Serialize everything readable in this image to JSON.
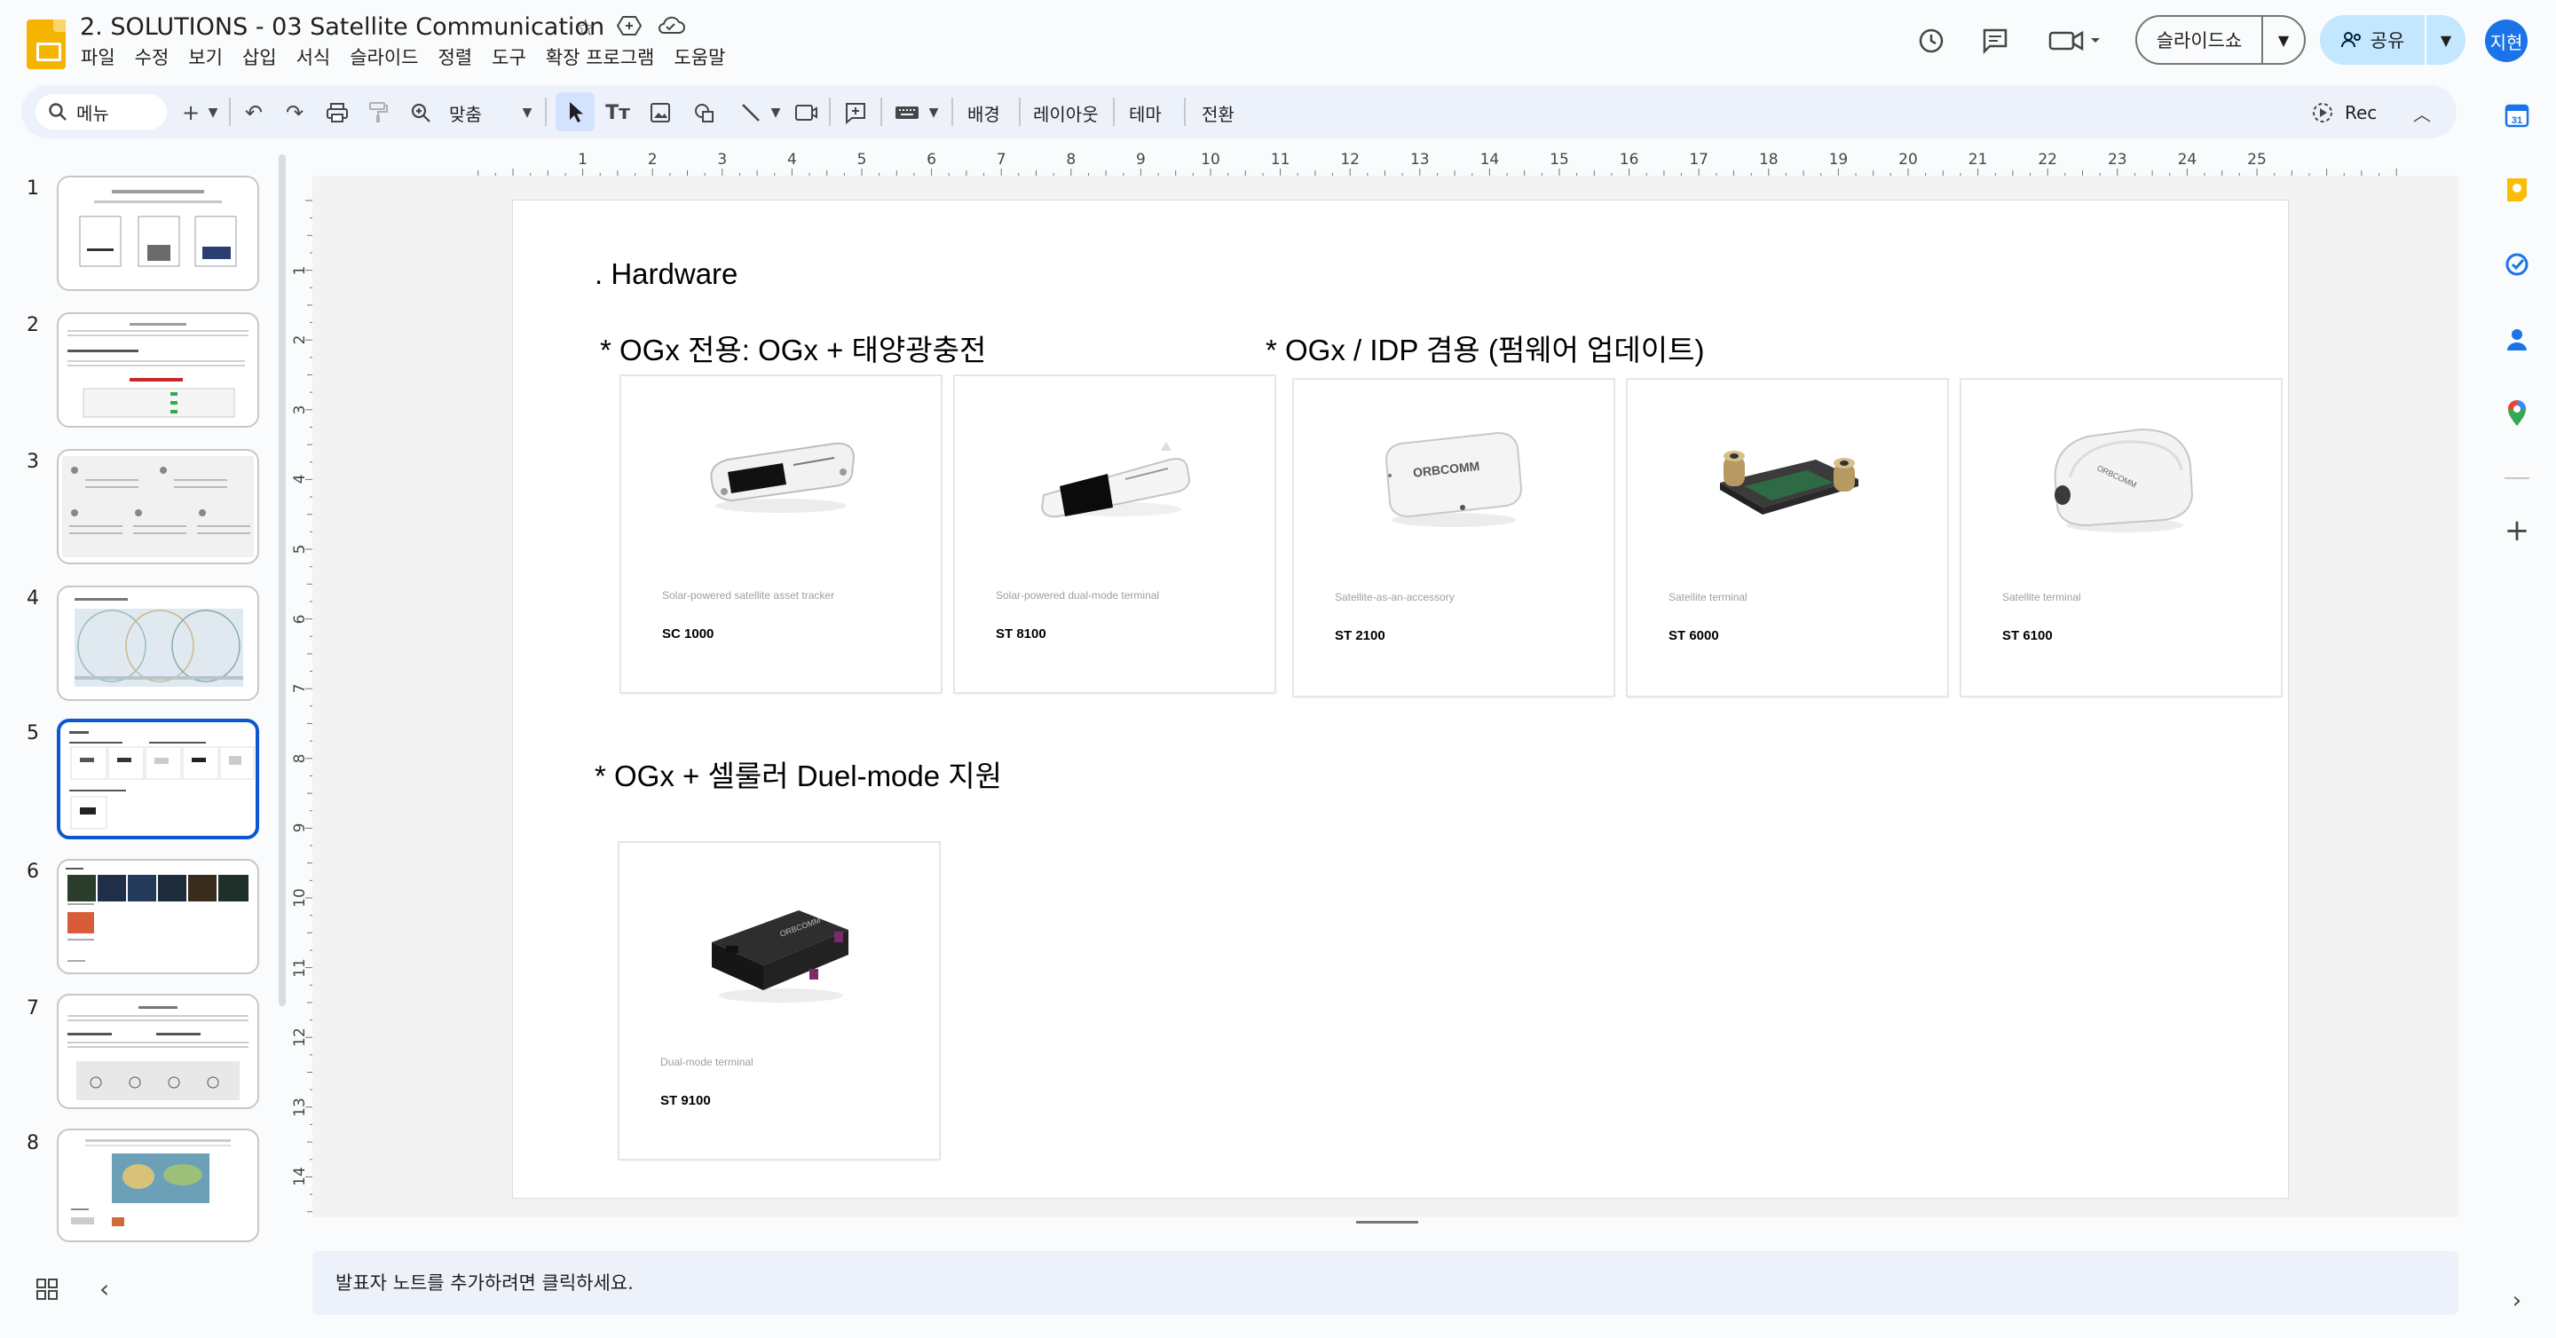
{
  "header": {
    "doc_title": "2. SOLUTIONS - 03 Satellite Communication",
    "menu": [
      "파일",
      "수정",
      "보기",
      "삽입",
      "서식",
      "슬라이드",
      "정렬",
      "도구",
      "확장 프로그램",
      "도움말"
    ],
    "slideshow_label": "슬라이드쇼",
    "share_label": "공유",
    "avatar_initials": "지현"
  },
  "toolbar": {
    "search_label": "메뉴",
    "zoom_label": "맞춤",
    "background_label": "배경",
    "layout_label": "레이아웃",
    "theme_label": "테마",
    "transition_label": "전환",
    "rec_label": "Rec"
  },
  "filmstrip": {
    "numbers": [
      "1",
      "2",
      "3",
      "4",
      "5",
      "6",
      "7",
      "8"
    ],
    "selected": 5
  },
  "rulers": {
    "horizontal": [
      "1",
      "2",
      "3",
      "4",
      "5",
      "6",
      "7",
      "8",
      "9",
      "10",
      "11",
      "12",
      "13",
      "14",
      "15",
      "16",
      "17",
      "18",
      "19",
      "20",
      "21",
      "22",
      "23",
      "24",
      "25"
    ],
    "vertical": [
      "1",
      "2",
      "3",
      "4",
      "5",
      "6",
      "7",
      "8",
      "9",
      "10",
      "11",
      "12",
      "13",
      "14"
    ]
  },
  "slide": {
    "heading": ". Hardware",
    "section1": "* OGx 전용: OGx + 태양광충전",
    "section2": "* OGx / IDP 겸용 (펌웨어 업데이트)",
    "section3": "* OGx + 셀룰러 Duel-mode 지원",
    "cards": [
      {
        "subtitle": "Solar-powered satellite asset tracker",
        "name": "SC 1000",
        "image": "solar-tracker-image"
      },
      {
        "subtitle": "Solar-powered dual-mode terminal",
        "name": "ST 8100",
        "image": "solar-terminal-image"
      },
      {
        "subtitle": "Satellite-as-an-accessory",
        "name": "ST 2100",
        "image": "accessory-terminal-image"
      },
      {
        "subtitle": "Satellite terminal",
        "name": "ST 6000",
        "image": "board-terminal-image"
      },
      {
        "subtitle": "Satellite terminal",
        "name": "ST 6100",
        "image": "dome-terminal-image"
      },
      {
        "subtitle": "Dual-mode terminal",
        "name": "ST 9100",
        "image": "dual-mode-terminal-image"
      }
    ]
  },
  "notes": {
    "placeholder": "발표자 노트를 추가하려면 클릭하세요."
  },
  "colors": {
    "accent": "#0b57d0",
    "share_bg": "#c2e7ff",
    "toolbar_bg": "#edf2fa",
    "doc_icon": "#f4b400"
  }
}
